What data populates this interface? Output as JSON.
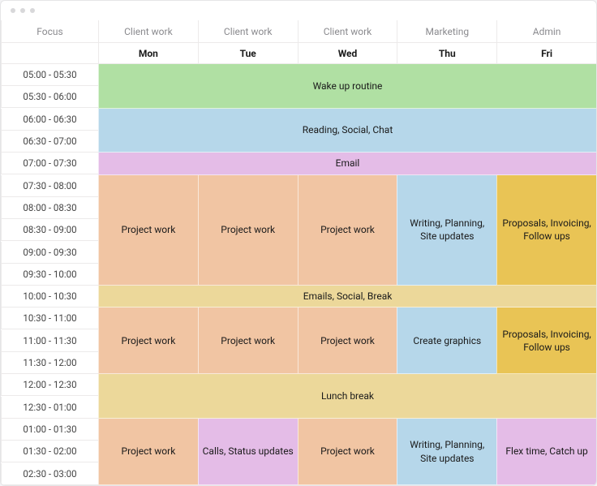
{
  "header": {
    "focus_label": "Focus",
    "categories": [
      "Client work",
      "Client work",
      "Client work",
      "Marketing",
      "Admin"
    ],
    "days": [
      "Mon",
      "Tue",
      "Wed",
      "Thu",
      "Fri"
    ]
  },
  "time_slots": [
    "05:00 - 05:30",
    "05:30 - 06:00",
    "06:00 - 06:30",
    "06:30 - 07:00",
    "07:00 - 07:30",
    "07:30 - 08:00",
    "08:00 - 08:30",
    "08:30 - 09:00",
    "09:00 - 09:30",
    "09:30 - 10:00",
    "10:00 - 10:30",
    "10:30 - 11:00",
    "11:00 - 11:30",
    "11:30 - 12:00",
    "12:00 - 12:30",
    "12:30 - 01:00",
    "01:00 - 01:30",
    "01:30 - 02:00",
    "02:30 - 03:00"
  ],
  "blocks": {
    "wake": {
      "label": "Wake up routine",
      "row_start": 3,
      "row_span": 2,
      "col_start": 2,
      "col_span": 5,
      "color": "green"
    },
    "reading": {
      "label": "Reading, Social, Chat",
      "row_start": 5,
      "row_span": 2,
      "col_start": 2,
      "col_span": 5,
      "color": "blue"
    },
    "email": {
      "label": "Email",
      "row_start": 7,
      "row_span": 1,
      "col_start": 2,
      "col_span": 5,
      "color": "violet"
    },
    "pw_mon_a": {
      "label": "Project work",
      "row_start": 8,
      "row_span": 5,
      "col_start": 2,
      "col_span": 1,
      "color": "peach"
    },
    "pw_tue_a": {
      "label": "Project work",
      "row_start": 8,
      "row_span": 5,
      "col_start": 3,
      "col_span": 1,
      "color": "peach"
    },
    "pw_wed_a": {
      "label": "Project work",
      "row_start": 8,
      "row_span": 5,
      "col_start": 4,
      "col_span": 1,
      "color": "peach"
    },
    "writing_a": {
      "label": "Writing, Planning, Site updates",
      "row_start": 8,
      "row_span": 5,
      "col_start": 5,
      "col_span": 1,
      "color": "skyblu"
    },
    "prop_a": {
      "label": "Proposals, Invoicing, Follow ups",
      "row_start": 8,
      "row_span": 5,
      "col_start": 6,
      "col_span": 1,
      "color": "gold"
    },
    "esb": {
      "label": "Emails, Social, Break",
      "row_start": 13,
      "row_span": 1,
      "col_start": 2,
      "col_span": 5,
      "color": "sand"
    },
    "pw_mon_b": {
      "label": "Project work",
      "row_start": 14,
      "row_span": 3,
      "col_start": 2,
      "col_span": 1,
      "color": "peach"
    },
    "pw_tue_b": {
      "label": "Project work",
      "row_start": 14,
      "row_span": 3,
      "col_start": 3,
      "col_span": 1,
      "color": "peach"
    },
    "pw_wed_b": {
      "label": "Project work",
      "row_start": 14,
      "row_span": 3,
      "col_start": 4,
      "col_span": 1,
      "color": "peach"
    },
    "graphics": {
      "label": "Create graphics",
      "row_start": 14,
      "row_span": 3,
      "col_start": 5,
      "col_span": 1,
      "color": "skyblu"
    },
    "prop_b": {
      "label": "Proposals, Invoicing, Follow ups",
      "row_start": 14,
      "row_span": 3,
      "col_start": 6,
      "col_span": 1,
      "color": "gold"
    },
    "lunch": {
      "label": "Lunch break",
      "row_start": 17,
      "row_span": 2,
      "col_start": 2,
      "col_span": 5,
      "color": "sand"
    },
    "pw_mon_c": {
      "label": "Project work",
      "row_start": 19,
      "row_span": 3,
      "col_start": 2,
      "col_span": 1,
      "color": "peach"
    },
    "calls": {
      "label": "Calls, Status updates",
      "row_start": 19,
      "row_span": 3,
      "col_start": 3,
      "col_span": 1,
      "color": "violet"
    },
    "pw_wed_c": {
      "label": "Project work",
      "row_start": 19,
      "row_span": 3,
      "col_start": 4,
      "col_span": 1,
      "color": "peach"
    },
    "writing_b": {
      "label": "Writing, Planning, Site updates",
      "row_start": 19,
      "row_span": 3,
      "col_start": 5,
      "col_span": 1,
      "color": "skyblu"
    },
    "flex": {
      "label": "Flex time, Catch up",
      "row_start": 19,
      "row_span": 3,
      "col_start": 6,
      "col_span": 1,
      "color": "violet"
    }
  }
}
